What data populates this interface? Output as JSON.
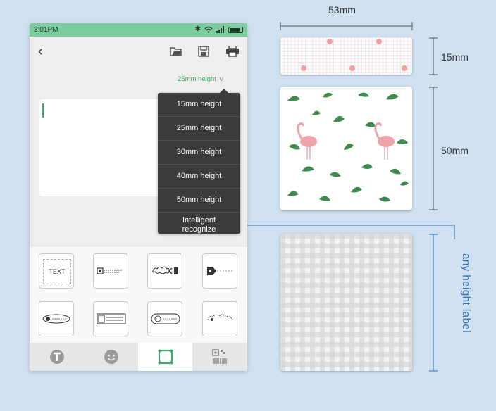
{
  "status_bar": {
    "time": "3:01PM"
  },
  "editor": {
    "height_selector_label": "25mm height"
  },
  "dropdown": {
    "options": [
      "15mm height",
      "25mm height",
      "30mm height",
      "40mm height",
      "50mm height",
      "Intelligent recognize"
    ]
  },
  "templates": {
    "first_label": "TEXT",
    "names": [
      "text-template",
      "id-card-template",
      "cloud-arrow-template",
      "tag-template",
      "badge-template",
      "grid-template",
      "circle-label-template",
      "dotted-cloud-template"
    ]
  },
  "bottom_nav": {
    "items": [
      "text-tab",
      "emoji-tab",
      "frame-tab",
      "barcode-tab"
    ],
    "active": "frame-tab"
  },
  "dimensions": {
    "width": "53mm",
    "height_small": "15mm",
    "height_large": "50mm",
    "any_height": "any height label"
  },
  "colors": {
    "accent": "#7ccca0",
    "link": "#3caa6a",
    "dropdown_bg": "#3b3b3b",
    "annotation": "#2f6fb5"
  }
}
